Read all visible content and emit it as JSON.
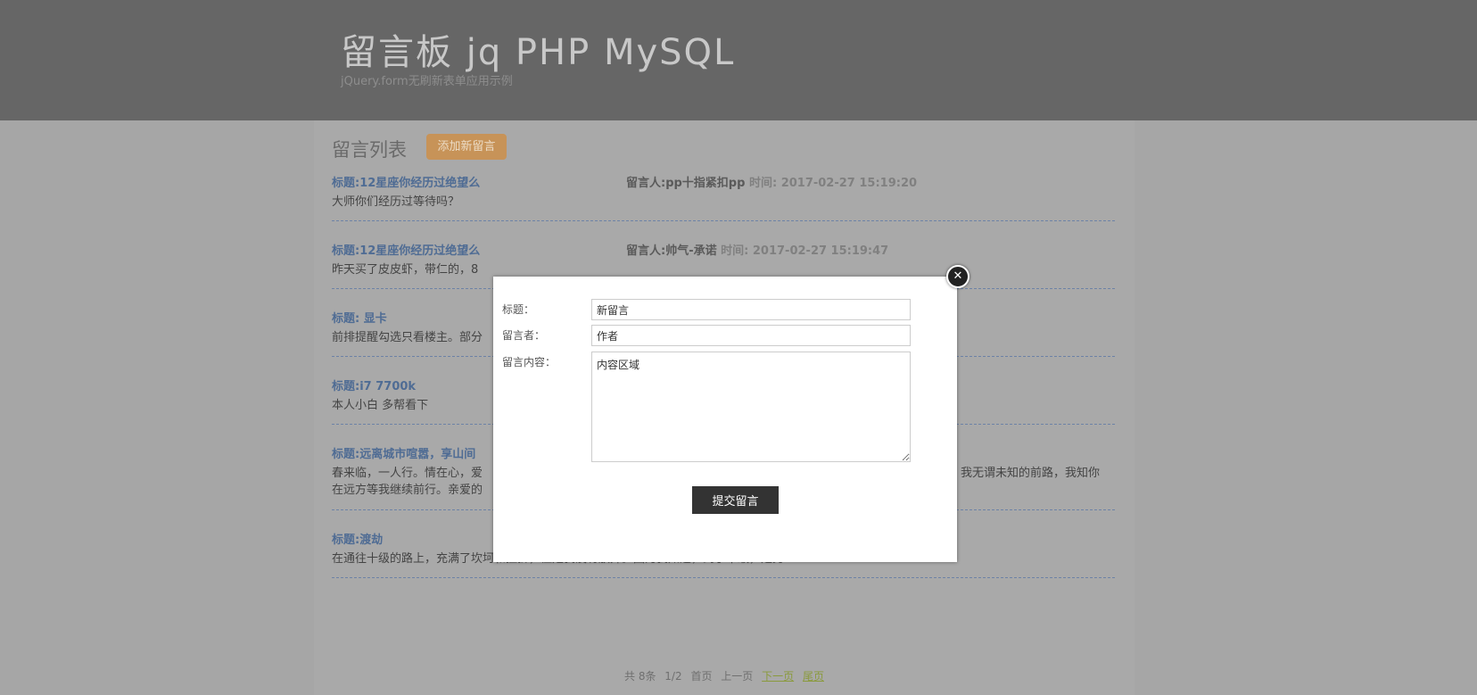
{
  "header": {
    "title": "留言板 jq PHP MySQL",
    "subtitle": "jQuery.form无刷新表单应用示例"
  },
  "list": {
    "heading": "留言列表",
    "add_button": "添加新留言",
    "time_label": "时间:",
    "messages": [
      {
        "title": "标题:12星座你经历过绝望么",
        "author": "留言人:pp十指紧扣pp",
        "time": "2017-02-27 15:19:20",
        "body": "大师你们经历过等待吗？"
      },
      {
        "title": "标题:12星座你经历过绝望么",
        "author": "留言人:帅气-承诺",
        "time": "2017-02-27 15:19:47",
        "body": "昨天买了皮皮虾，带仁的，8"
      },
      {
        "title": "标题: 显卡",
        "author": "",
        "time": "",
        "body": "前排提醒勾选只看楼主。部分"
      },
      {
        "title": "标题:i7 7700k",
        "author": "",
        "time": "",
        "body": "本人小白 多帮看下"
      },
      {
        "title": "标题:远离城市喧嚣，享山间",
        "author": "",
        "time": "",
        "body": "春来临，一人行。情在心，爱",
        "body_right": "我无谓未知的前路，我知你",
        "body2": "在远方等我继续前行。亲爱的"
      },
      {
        "title": "标题:渡劫",
        "author": "",
        "time": "",
        "body": "在通往十级的路上，充满了坎坷和挫折，但是我没有放弃。因为我知道，到了十级，是另一"
      }
    ]
  },
  "pager": {
    "total": "共 8条",
    "page": "1/2",
    "first": "首页",
    "prev": "上一页",
    "next": "下一页",
    "last": "尾页"
  },
  "modal": {
    "title_label": "标题：",
    "title_value": "新留言",
    "author_label": "留言者：",
    "author_value": "作者",
    "content_label": "留言内容：",
    "content_value": "内容区域",
    "submit_label": "提交留言",
    "close_icon": "close-icon"
  }
}
